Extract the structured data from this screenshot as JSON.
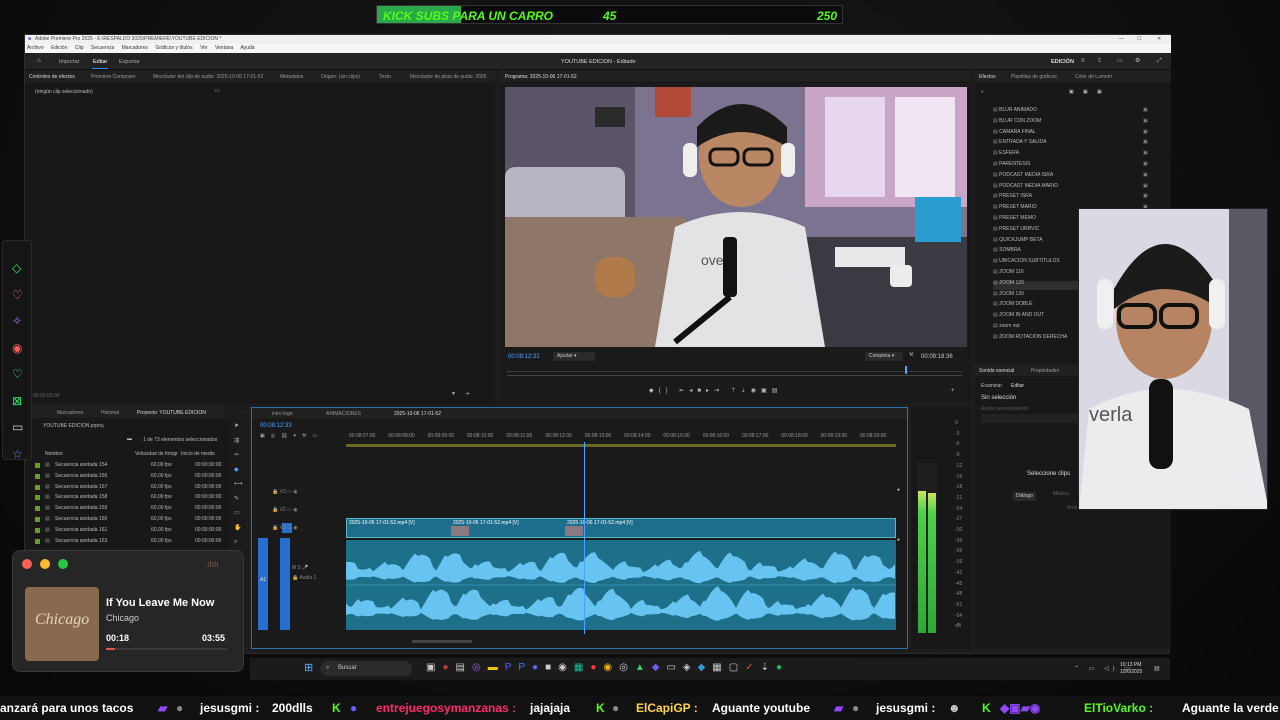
{
  "kick": {
    "label": "KICK SUBS PARA UN CARRO",
    "current": "45",
    "goal": "250",
    "progress": 0.18
  },
  "window": {
    "title": "Adobe Premiere Pro 2025 - E:\\RESPALDO 2025\\PREMIERE\\YOUTUBE EDICION *",
    "menu": [
      "Archivo",
      "Edición",
      "Clip",
      "Secuencia",
      "Marcadores",
      "Gráficos y títulos",
      "Ver",
      "Ventana",
      "Ayuda"
    ],
    "tabs": {
      "importar": "Importar",
      "editar": "Editar",
      "exportar": "Exportar"
    },
    "project_title": "YOUTUBE EDICION - Editado",
    "workspace": "EDICIÓN"
  },
  "source": {
    "tabs": [
      "Controles de efectos",
      "Premiere Composer",
      "Mezclador del clip de audio: 2025-10-06 17-01-52",
      "Metadatos",
      "Origen: (sin clips)",
      "Texto",
      "Mezclador de pista de audio: 2025"
    ],
    "empty": "(ningún clip seleccionado)",
    "timecode": "00:00:00:00"
  },
  "program": {
    "label": "Programa: 2025-10-06 17-01-52",
    "timecode": "00:08:12:32",
    "fit": "Ajustar",
    "quality": "Completa",
    "duration": "00:09:18:36"
  },
  "effects": {
    "tabs": [
      "Efectos",
      "Plantillas de gráficos",
      "Color de Lumetri"
    ],
    "items": [
      "BLUR ANIMADO",
      "BLUR CON ZOOM",
      "CAMARA FINAL",
      "ENTRADA Y SALIDA",
      "ESFERA",
      "PARENTESIS",
      "PODCAST MEDIA ISRA",
      "PODCAST MEDIA MARIO",
      "PRESET ISRA",
      "PRESET MARIO",
      "PRESET MEMO",
      "PRESET URBVIC",
      "QUICKJUMP BETA",
      "SOMBRA",
      "UBICACION SUBTITULOS",
      "ZOOM 110",
      "ZOOM 120",
      "ZOOM 130",
      "ZOOM DOBLE",
      "ZOOM IN AND OUT",
      "zoom out",
      "ZOOM ROTACION DERECHA"
    ]
  },
  "essential": {
    "tabs": [
      "Sonido esencial",
      "Propiedades"
    ],
    "subtabs": [
      "Examinar",
      "Editar"
    ],
    "status": "Sin selección",
    "preset": "Ajuste preestablecido",
    "prompt": "Seleccione clips",
    "dialog": "Diálogo",
    "music": "Música",
    "ambient": "Amb"
  },
  "project": {
    "tabs": [
      "Marcadores",
      "Historial",
      "Proyecto: YOUTUBE EDICION"
    ],
    "file": "YOUTUBE EDICION.prproj",
    "count": "1 de 73 elementos seleccionados",
    "headers": [
      "Nombre",
      "Velocidad de fotogr",
      "Inicio de medio"
    ],
    "rows": [
      {
        "name": "Secuencia anidada 154",
        "fps": "60,00 fps",
        "start": "00:00:00:00"
      },
      {
        "name": "Secuencia anidada 156",
        "fps": "60,00 fps",
        "start": "00:00:00:00"
      },
      {
        "name": "Secuencia anidada 157",
        "fps": "60,00 fps",
        "start": "00:00:00:00"
      },
      {
        "name": "Secuencia anidada 158",
        "fps": "60,00 fps",
        "start": "00:00:00:00"
      },
      {
        "name": "Secuencia anidada 159",
        "fps": "60,00 fps",
        "start": "00:00:00:00"
      },
      {
        "name": "Secuencia anidada 160",
        "fps": "60,00 fps",
        "start": "00:00:00:00"
      },
      {
        "name": "Secuencia anidada 161",
        "fps": "60,00 fps",
        "start": "00:00:00:00"
      },
      {
        "name": "Secuencia anidada 163",
        "fps": "60,00 fps",
        "start": "00:00:00:00"
      }
    ]
  },
  "timeline": {
    "tabs": [
      "intro logo",
      "ANIMACIONES",
      "2025-10-06 17-01-52"
    ],
    "timecode": "00:08:12:33",
    "ruler": [
      "00:08:07:00",
      "00:08:08:00",
      "00:08:09:00",
      "00:08:10:00",
      "00:08:11:00",
      "00:08:12:00",
      "00:08:13:00",
      "00:08:14:00",
      "00:08:15:00",
      "00:08:16:00",
      "00:08:17:00",
      "00:08:18:00",
      "00:08:19:00",
      "00:08:20:00"
    ],
    "tracks": [
      "V3",
      "V2",
      "V1",
      "A1"
    ],
    "audio_label": "Audio 1",
    "clip_name": "2025-10-06 17-01-52.mp4 [V]"
  },
  "meter": {
    "scale": [
      "0",
      "-3",
      "-6",
      "-9",
      "-12",
      "-15",
      "-18",
      "-21",
      "-24",
      "-27",
      "-30",
      "-33",
      "-36",
      "-39",
      "-42",
      "-45",
      "-48",
      "-51",
      "-54",
      "dB"
    ]
  },
  "music": {
    "title": "If You Leave Me Now",
    "artist": "Chicago",
    "elapsed": "00:18",
    "total": "03:55",
    "progress": 0.077,
    "album": "Chicago"
  },
  "taskbar": {
    "search": "Buscar",
    "time": "10:13 PM",
    "date": "10/6/2025"
  },
  "ticker": [
    {
      "user": "",
      "text": "anzará para unos tacos",
      "color": "#ffffff"
    },
    {
      "user": "jesusgmi :",
      "text": "200dlls",
      "color": "#ffffff"
    },
    {
      "user": "entrejuegosymanzanas :",
      "text": "jajajaja",
      "color": "#ff2a6d"
    },
    {
      "user": "ElCapiGP :",
      "text": "Aguante youtube",
      "color": "#ffd54a"
    },
    {
      "user": "jesusgmi :",
      "text": "",
      "color": "#ffffff"
    },
    {
      "user": "ElTioVarko :",
      "text": "Aguante la verde",
      "color": "#53fc18"
    }
  ]
}
